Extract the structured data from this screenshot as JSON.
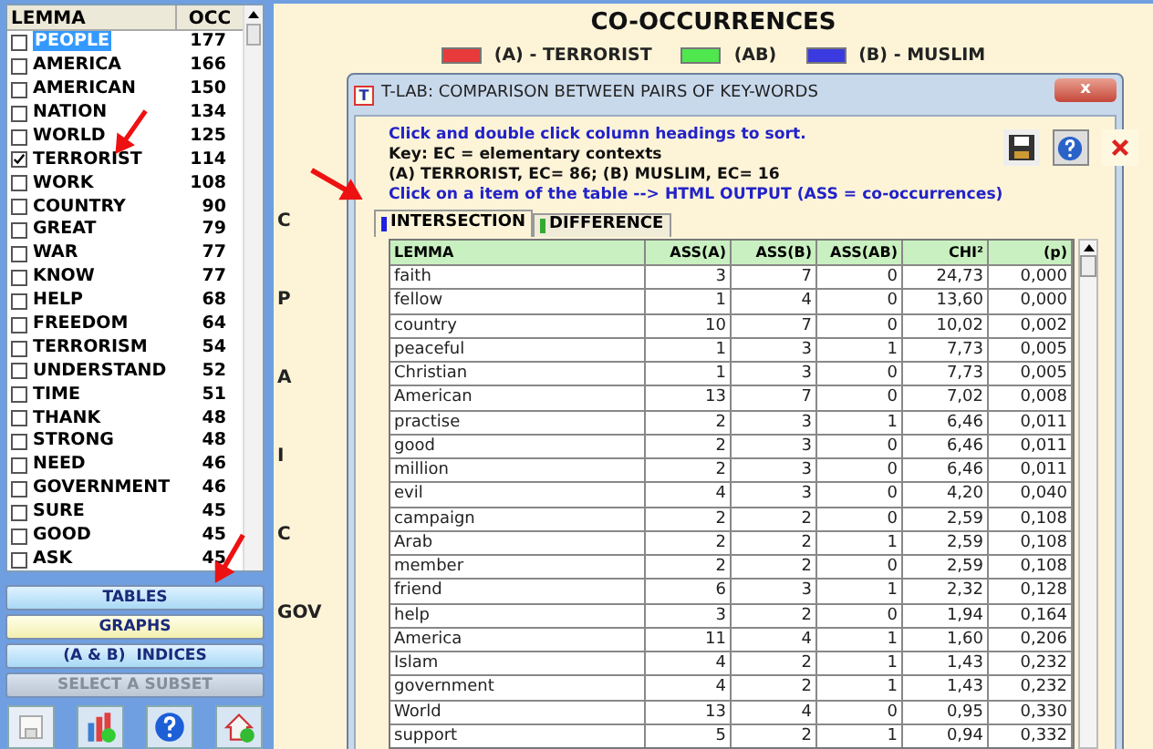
{
  "lemma_list": {
    "columns": [
      "LEMMA",
      "OCC"
    ],
    "rows": [
      {
        "lemma": "PEOPLE",
        "occ": "177",
        "checked": false,
        "selected": true
      },
      {
        "lemma": "AMERICA",
        "occ": "166",
        "checked": false,
        "selected": false
      },
      {
        "lemma": "AMERICAN",
        "occ": "150",
        "checked": false,
        "selected": false
      },
      {
        "lemma": "NATION",
        "occ": "134",
        "checked": false,
        "selected": false
      },
      {
        "lemma": "WORLD",
        "occ": "125",
        "checked": false,
        "selected": false
      },
      {
        "lemma": "TERRORIST",
        "occ": "114",
        "checked": true,
        "selected": false
      },
      {
        "lemma": "WORK",
        "occ": "108",
        "checked": false,
        "selected": false
      },
      {
        "lemma": "COUNTRY",
        "occ": "90",
        "checked": false,
        "selected": false
      },
      {
        "lemma": "GREAT",
        "occ": "79",
        "checked": false,
        "selected": false
      },
      {
        "lemma": "WAR",
        "occ": "77",
        "checked": false,
        "selected": false
      },
      {
        "lemma": "KNOW",
        "occ": "77",
        "checked": false,
        "selected": false
      },
      {
        "lemma": "HELP",
        "occ": "68",
        "checked": false,
        "selected": false
      },
      {
        "lemma": "FREEDOM",
        "occ": "64",
        "checked": false,
        "selected": false
      },
      {
        "lemma": "TERRORISM",
        "occ": "54",
        "checked": false,
        "selected": false
      },
      {
        "lemma": "UNDERSTAND",
        "occ": "52",
        "checked": false,
        "selected": false
      },
      {
        "lemma": "TIME",
        "occ": "51",
        "checked": false,
        "selected": false
      },
      {
        "lemma": "THANK",
        "occ": "48",
        "checked": false,
        "selected": false
      },
      {
        "lemma": "STRONG",
        "occ": "48",
        "checked": false,
        "selected": false
      },
      {
        "lemma": "NEED",
        "occ": "46",
        "checked": false,
        "selected": false
      },
      {
        "lemma": "GOVERNMENT",
        "occ": "46",
        "checked": false,
        "selected": false
      },
      {
        "lemma": "SURE",
        "occ": "45",
        "checked": false,
        "selected": false
      },
      {
        "lemma": "GOOD",
        "occ": "45",
        "checked": false,
        "selected": false
      },
      {
        "lemma": "ASK",
        "occ": "45",
        "checked": false,
        "selected": false
      }
    ]
  },
  "side_buttons": [
    {
      "label": "TABLES",
      "kind": "blue",
      "disabled": false
    },
    {
      "label": "GRAPHS",
      "kind": "yellow",
      "disabled": false
    },
    {
      "label": "(A & B)  INDICES",
      "kind": "blue",
      "disabled": false
    },
    {
      "label": "SELECT A SUBSET",
      "kind": "grey",
      "disabled": true
    }
  ],
  "main": {
    "title": "CO-OCCURRENCES",
    "legend": [
      {
        "label": "(A) - TERRORIST",
        "color": "#e83a3a"
      },
      {
        "label": "(AB)",
        "color": "#4ee84e"
      },
      {
        "label": "(B) - MUSLIM",
        "color": "#3a3ae0"
      }
    ],
    "background_fragments": [
      "C",
      "P",
      "A",
      "I",
      "C",
      "GOV"
    ]
  },
  "dialog": {
    "logo_letter": "T",
    "title": "T-LAB: COMPARISON BETWEEN PAIRS OF KEY-WORDS",
    "close_label": "x",
    "notes": [
      {
        "text": "Click and double click column headings to sort.",
        "kind": "hint"
      },
      {
        "text": "Key: EC = elementary contexts",
        "kind": "info"
      },
      {
        "text": "(A) TERRORIST, EC= 86; (B) MUSLIM, EC= 16",
        "kind": "info"
      },
      {
        "text": "Click on a item of the table --> HTML OUTPUT (ASS = co-occurrences)",
        "kind": "hint"
      }
    ],
    "tabs": [
      {
        "label": "INTERSECTION",
        "selected": true
      },
      {
        "label": "DIFFERENCE",
        "selected": false
      }
    ],
    "table": {
      "columns": [
        "LEMMA",
        "ASS(A)",
        "ASS(B)",
        "ASS(AB)",
        "CHI²",
        "(p)"
      ],
      "rows": [
        [
          "faith",
          "3",
          "7",
          "0",
          "24,73",
          "0,000"
        ],
        [
          "fellow",
          "1",
          "4",
          "0",
          "13,60",
          "0,000"
        ],
        [
          "country",
          "10",
          "7",
          "0",
          "10,02",
          "0,002"
        ],
        [
          "peaceful",
          "1",
          "3",
          "1",
          "7,73",
          "0,005"
        ],
        [
          "Christian",
          "1",
          "3",
          "0",
          "7,73",
          "0,005"
        ],
        [
          "American",
          "13",
          "7",
          "0",
          "7,02",
          "0,008"
        ],
        [
          "practise",
          "2",
          "3",
          "1",
          "6,46",
          "0,011"
        ],
        [
          "good",
          "2",
          "3",
          "0",
          "6,46",
          "0,011"
        ],
        [
          "million",
          "2",
          "3",
          "0",
          "6,46",
          "0,011"
        ],
        [
          "evil",
          "4",
          "3",
          "0",
          "4,20",
          "0,040"
        ],
        [
          "campaign",
          "2",
          "2",
          "0",
          "2,59",
          "0,108"
        ],
        [
          "Arab",
          "2",
          "2",
          "1",
          "2,59",
          "0,108"
        ],
        [
          "member",
          "2",
          "2",
          "0",
          "2,59",
          "0,108"
        ],
        [
          "friend",
          "6",
          "3",
          "1",
          "2,32",
          "0,128"
        ],
        [
          "help",
          "3",
          "2",
          "0",
          "1,94",
          "0,164"
        ],
        [
          "America",
          "11",
          "4",
          "1",
          "1,60",
          "0,206"
        ],
        [
          "Islam",
          "4",
          "2",
          "1",
          "1,43",
          "0,232"
        ],
        [
          "government",
          "4",
          "2",
          "1",
          "1,43",
          "0,232"
        ],
        [
          "World",
          "13",
          "4",
          "0",
          "0,95",
          "0,330"
        ],
        [
          "support",
          "5",
          "2",
          "1",
          "0,94",
          "0,332"
        ]
      ]
    }
  }
}
